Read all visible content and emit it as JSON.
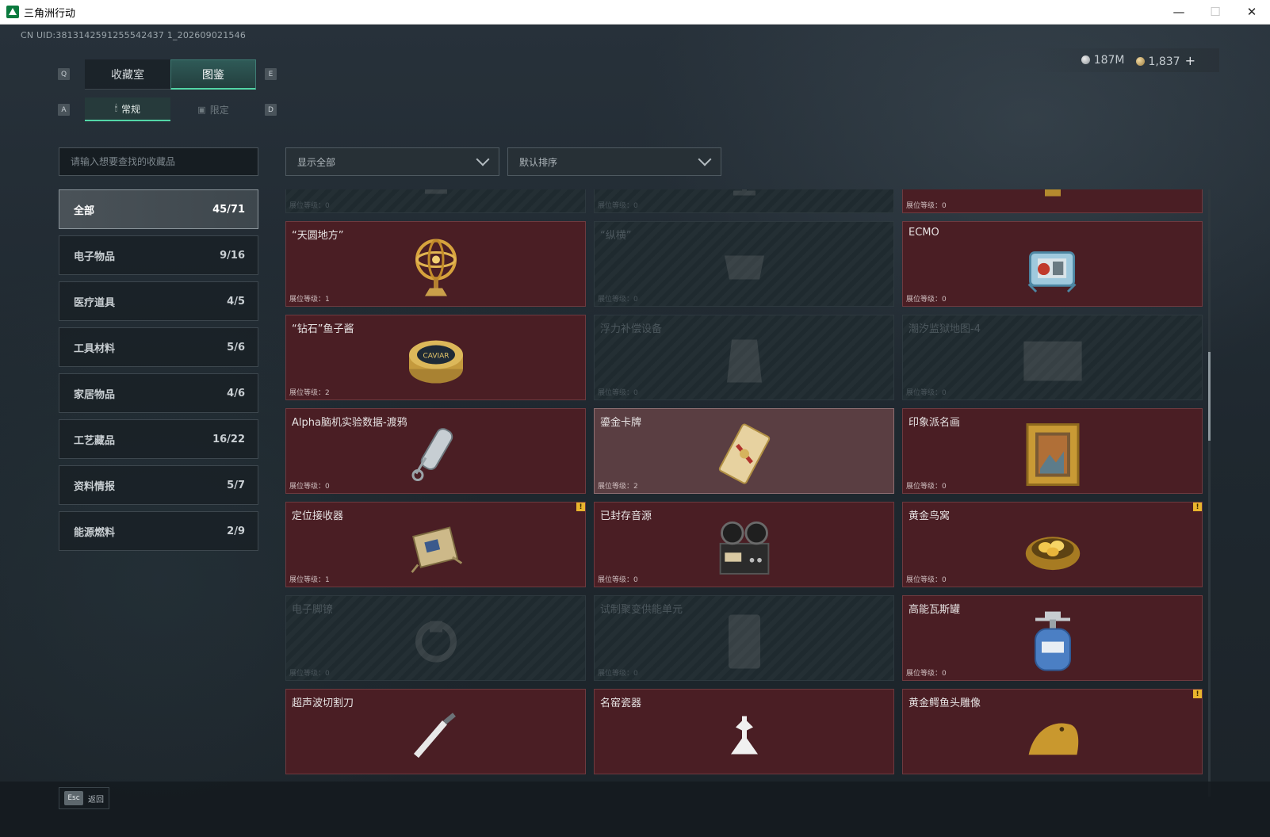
{
  "window": {
    "title": "三角洲行动",
    "minimize": "—",
    "maximize": "☐",
    "close": "✕"
  },
  "uid": "CN UID:3813142591255542437 1_202609021546",
  "keys": {
    "q": "Q",
    "e": "E",
    "a": "A",
    "d": "D"
  },
  "tabs": [
    {
      "label": "收藏室",
      "active": false
    },
    {
      "label": "图鉴",
      "active": true
    }
  ],
  "subtabs": [
    {
      "label": "常规",
      "active": true
    },
    {
      "label": "限定",
      "active": false
    }
  ],
  "currency": {
    "silver": "187M",
    "gold": "1,837",
    "plus": "+"
  },
  "search": {
    "placeholder": "请输入想要查找的收藏品"
  },
  "categories": [
    {
      "label": "全部",
      "count": "45/71",
      "active": true
    },
    {
      "label": "电子物品",
      "count": "9/16"
    },
    {
      "label": "医疗道具",
      "count": "4/5"
    },
    {
      "label": "工具材料",
      "count": "5/6"
    },
    {
      "label": "家居物品",
      "count": "4/6"
    },
    {
      "label": "工艺藏品",
      "count": "16/22"
    },
    {
      "label": "资料情报",
      "count": "5/7"
    },
    {
      "label": "能源燃料",
      "count": "2/9"
    }
  ],
  "filters": {
    "display": "显示全部",
    "sort": "默认排序"
  },
  "level_label": "展位等级：",
  "items": [
    {
      "name": "",
      "level": "0",
      "locked": true,
      "icon": "trophy-icon"
    },
    {
      "name": "",
      "level": "0",
      "locked": true,
      "icon": "globe-lamp-icon"
    },
    {
      "name": "",
      "level": "0",
      "locked": false,
      "icon": "jeweled-egg-icon"
    },
    {
      "name": "“天圆地方”",
      "level": "1",
      "locked": false,
      "icon": "armillary-sphere-icon"
    },
    {
      "name": "“纵横”",
      "level": "0",
      "locked": true,
      "icon": "chessboard-icon"
    },
    {
      "name": "ECMO",
      "level": "0",
      "locked": false,
      "icon": "ecmo-machine-icon"
    },
    {
      "name": "“钻石”鱼子酱",
      "level": "2",
      "locked": false,
      "icon": "caviar-tin-icon"
    },
    {
      "name": "浮力补偿设备",
      "level": "0",
      "locked": true,
      "icon": "buoyancy-vest-icon"
    },
    {
      "name": "潮汐监狱地图-4",
      "level": "0",
      "locked": true,
      "icon": "map-icon"
    },
    {
      "name": "Alpha脑机实验数据-渡鸦",
      "level": "0",
      "locked": false,
      "icon": "data-capsule-icon"
    },
    {
      "name": "鎏金卡牌",
      "level": "2",
      "locked": false,
      "highlight": true,
      "icon": "gold-card-icon"
    },
    {
      "name": "印象派名画",
      "level": "0",
      "locked": false,
      "icon": "framed-painting-icon"
    },
    {
      "name": "定位接收器",
      "level": "1",
      "locked": false,
      "badge": "!",
      "icon": "gps-receiver-icon"
    },
    {
      "name": "已封存音源",
      "level": "0",
      "locked": false,
      "icon": "reel-recorder-icon"
    },
    {
      "name": "黄金鸟窝",
      "level": "0",
      "locked": false,
      "badge": "!",
      "icon": "golden-nest-icon"
    },
    {
      "name": "电子脚镣",
      "level": "0",
      "locked": true,
      "icon": "ankle-monitor-icon"
    },
    {
      "name": "试制聚变供能单元",
      "level": "0",
      "locked": true,
      "icon": "fusion-cell-icon"
    },
    {
      "name": "高能瓦斯罐",
      "level": "0",
      "locked": false,
      "icon": "gas-canister-icon"
    },
    {
      "name": "超声波切割刀",
      "level": "",
      "locked": false,
      "icon": "ultrasonic-knife-icon"
    },
    {
      "name": "名窑瓷器",
      "level": "",
      "locked": false,
      "icon": "porcelain-icon"
    },
    {
      "name": "黄金鳄鱼头雕像",
      "level": "",
      "locked": false,
      "badge": "!",
      "icon": "gold-croc-head-icon"
    }
  ],
  "footer": {
    "key": "Esc",
    "label": "返回"
  },
  "colors": {
    "accent": "#52d6a6",
    "card_owned": "#4a1e24",
    "card_locked": "#1f2a2f",
    "badge": "#e9b52d"
  }
}
